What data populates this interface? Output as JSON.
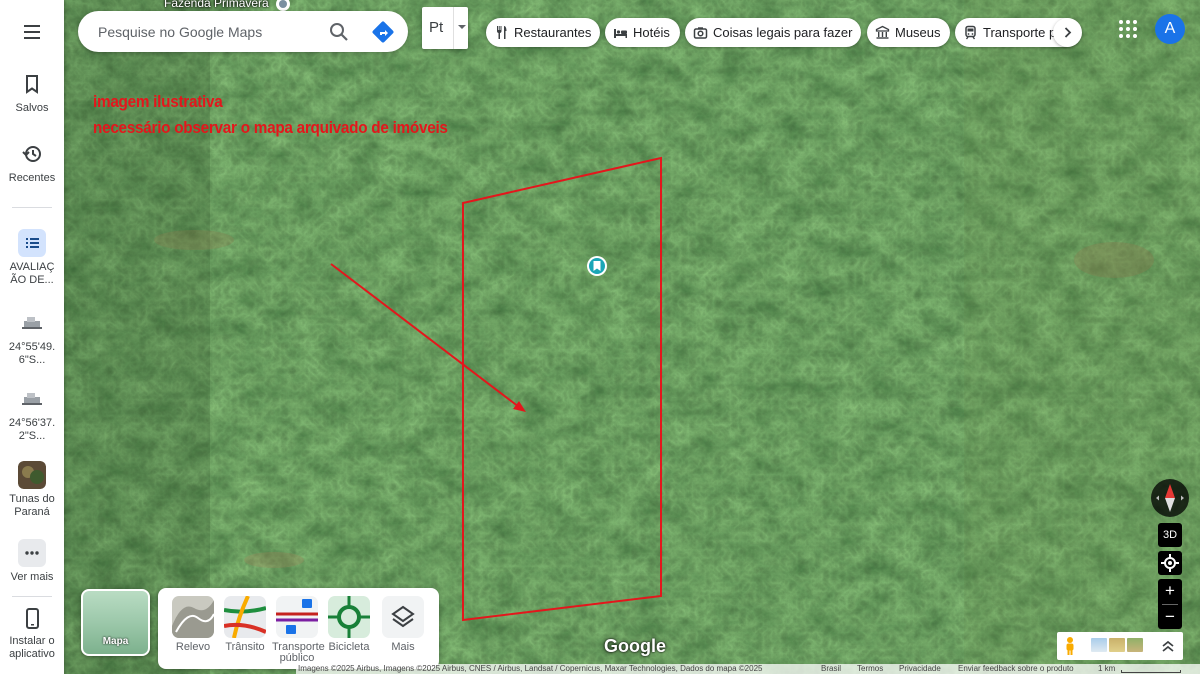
{
  "rail": {
    "saved": "Salvos",
    "recent": "Recentes",
    "items": [
      {
        "label": "AVALIAÇ ÃO DE..."
      },
      {
        "label": "24°55'49. 6\"S..."
      },
      {
        "label": "24°56'37. 2\"S..."
      },
      {
        "label": "Tunas do Paraná"
      },
      {
        "label": "Ver mais"
      }
    ],
    "install": "Instalar o aplicativo"
  },
  "search": {
    "placeholder": "Pesquise no Google Maps"
  },
  "language": {
    "value": "Pt"
  },
  "chips": [
    {
      "label": "Restaurantes",
      "icon": "fork-knife-icon"
    },
    {
      "label": "Hotéis",
      "icon": "bed-icon"
    },
    {
      "label": "Coisas legais para fazer",
      "icon": "camera-icon"
    },
    {
      "label": "Museus",
      "icon": "museum-icon"
    },
    {
      "label": "Transporte público",
      "icon": "train-icon"
    }
  ],
  "account": {
    "initial": "A",
    "color": "#1a73e8"
  },
  "map": {
    "place_label": "Fazenda Primavera",
    "note_line1": "imagem ilustrativa",
    "note_line2": "necessário observar o mapa arquivado de imóveis",
    "annotation_color": "#e4161c"
  },
  "controls": {
    "three_d": "3D",
    "zoom_in": "+",
    "zoom_out": "−"
  },
  "layers": {
    "base": "Mapa",
    "options": [
      {
        "label": "Relevo"
      },
      {
        "label": "Trânsito"
      },
      {
        "label": "Transporte público"
      },
      {
        "label": "Bicicleta"
      },
      {
        "label": "Mais"
      }
    ]
  },
  "logo": "Google",
  "attribution": {
    "imagery": "Imagens ©2025 Airbus, Imagens ©2025 Airbus, CNES / Airbus, Landsat / Copernicus, Maxar Technologies, Dados do mapa ©2025",
    "country": "Brasil",
    "terms": "Termos",
    "privacy": "Privacidade",
    "feedback": "Enviar feedback sobre o produto",
    "scale": "1 km"
  }
}
